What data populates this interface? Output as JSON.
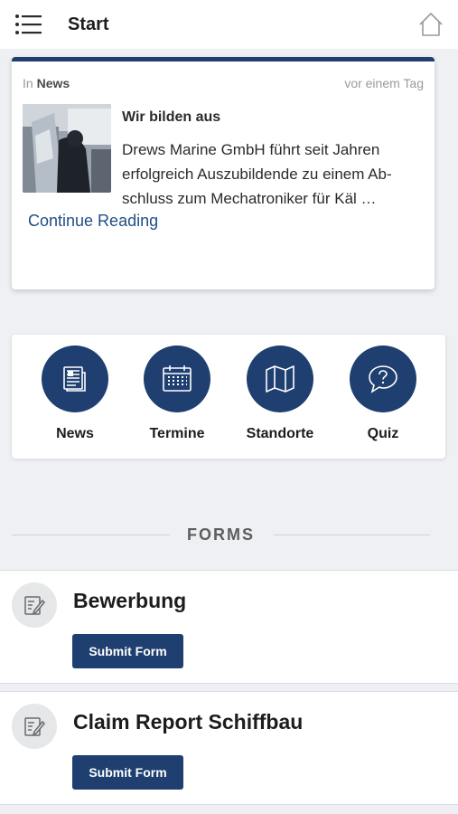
{
  "header": {
    "title": "Start",
    "menu_icon": "list-menu-icon",
    "home_icon": "home-icon"
  },
  "news_card": {
    "category_prefix": "In",
    "category": "News",
    "timestamp": "vor einem Tag",
    "title": "Wir bilden aus",
    "excerpt": "Drews Marine GmbH führt seit Jahren erfolgreich Auszubildende zu einem Ab-schluss zum Mechatroniker für Käl …",
    "read_more": "Continue Reading",
    "accent_color": "#1f3f70"
  },
  "shortcuts": [
    {
      "label": "News",
      "icon": "newspaper-icon"
    },
    {
      "label": "Termine",
      "icon": "calendar-icon"
    },
    {
      "label": "Standorte",
      "icon": "map-icon"
    },
    {
      "label": "Quiz",
      "icon": "question-bubble-icon"
    }
  ],
  "forms": {
    "section_title": "FORMS",
    "items": [
      {
        "title": "Bewerbung",
        "button": "Submit Form",
        "icon": "edit-form-icon"
      },
      {
        "title": "Claim Report Schiffbau",
        "button": "Submit Form",
        "icon": "edit-form-icon"
      }
    ]
  },
  "colors": {
    "brand": "#1f3f70",
    "link": "#1f4f86",
    "background": "#eef0f4"
  }
}
